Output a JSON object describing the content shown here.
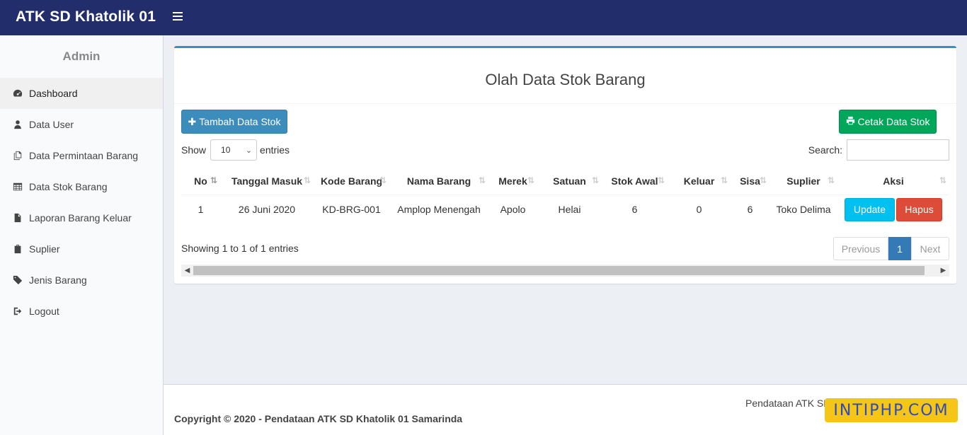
{
  "app": {
    "title": "ATK SD Khatolik 01"
  },
  "sidebar": {
    "user_label": "Admin",
    "items": [
      {
        "label": "Dashboard",
        "icon": "dashboard-icon"
      },
      {
        "label": "Data User",
        "icon": "user-icon"
      },
      {
        "label": "Data Permintaan Barang",
        "icon": "copy-icon"
      },
      {
        "label": "Data Stok Barang",
        "icon": "table-icon"
      },
      {
        "label": "Laporan Barang Keluar",
        "icon": "file-icon"
      },
      {
        "label": "Suplier",
        "icon": "suitcase-icon"
      },
      {
        "label": "Jenis Barang",
        "icon": "tags-icon"
      },
      {
        "label": "Logout",
        "icon": "sign-out-icon"
      }
    ]
  },
  "main": {
    "title": "Olah Data Stok Barang",
    "add_button": "Tambah Data Stok",
    "print_button": "Cetak Data Stok",
    "show_label": "Show",
    "entries_value": "10",
    "entries_label": "entries",
    "search_label": "Search:",
    "search_value": "",
    "columns": [
      "No",
      "Tanggal Masuk",
      "Kode Barang",
      "Nama Barang",
      "Merek",
      "Satuan",
      "Stok Awal",
      "Keluar",
      "Sisa",
      "Suplier",
      "Aksi"
    ],
    "rows": [
      {
        "no": "1",
        "tanggal": "26 Juni 2020",
        "kode": "KD-BRG-001",
        "nama": "Amplop Menengah",
        "merek": "Apolo",
        "satuan": "Helai",
        "stok_awal": "6",
        "keluar": "0",
        "sisa": "6",
        "suplier": "Toko Delima",
        "update": "Update",
        "hapus": "Hapus"
      }
    ],
    "info": "Showing 1 to 1 of 1 entries",
    "pagination": {
      "previous": "Previous",
      "current": "1",
      "next": "Next"
    }
  },
  "footer": {
    "copyright": "Copyright © 2020 - Pendataan ATK SD Khatolik 01 Samarinda",
    "right_text": "Pendataan ATK SD",
    "watermark": "INTIPHP.COM"
  },
  "colors": {
    "topbar": "#222d6b",
    "accent": "#3c8dbc",
    "success": "#00a65a",
    "info": "#00c0ef",
    "danger": "#dd4b39"
  }
}
